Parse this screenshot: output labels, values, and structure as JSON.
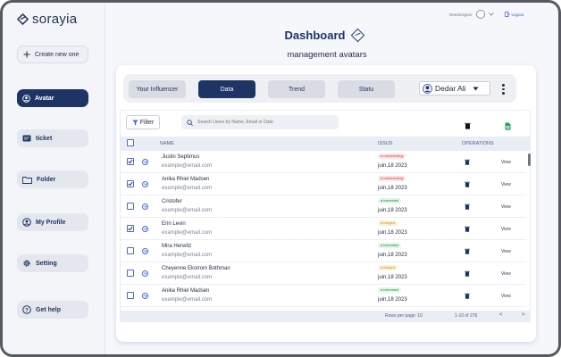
{
  "app": {
    "name": "sorayia"
  },
  "sidebar": {
    "create_label": "Create new one",
    "items": [
      {
        "label": "Avatar",
        "icon": "user-circle-icon",
        "active": true
      },
      {
        "label": "ticket",
        "icon": "ticket-icon",
        "active": false
      },
      {
        "label": "Folder",
        "icon": "folder-icon",
        "active": false
      },
      {
        "label": "My Profile",
        "icon": "profile-icon",
        "active": false
      },
      {
        "label": "Setting",
        "icon": "gear-icon",
        "active": false
      },
      {
        "label": "Get help",
        "icon": "help-icon",
        "active": false
      }
    ]
  },
  "topbar": {
    "username": "Deedesigner",
    "logout_label": "Logout"
  },
  "header": {
    "title": "Dashboard",
    "subtitle": "management avatars"
  },
  "tabs": [
    {
      "label": "Your Influencer",
      "active": false
    },
    {
      "label": "Data",
      "active": true
    },
    {
      "label": "Trend",
      "active": false
    },
    {
      "label": "Statu",
      "active": false
    }
  ],
  "user_select": {
    "value": "Dedar Ali"
  },
  "toolbar": {
    "filter_label": "Filter",
    "search_placeholder": "Search Users by Name, Email or Date"
  },
  "table": {
    "columns": {
      "name": "NAME",
      "issus": "ISSUS",
      "operations": "OPERATIONS"
    },
    "view_label": "View",
    "rows": [
      {
        "name": "Justin Septimus",
        "email": "example@email.com",
        "status": "uninteresting",
        "status_color": "red",
        "date": "juin,18 2023",
        "checked": true
      },
      {
        "name": "Anika Rhiel Madsen",
        "email": "example@email.com",
        "status": "uninteresting",
        "status_color": "red",
        "date": "juin,18 2023",
        "checked": true
      },
      {
        "name": "Cristofer",
        "email": "example@email.com",
        "status": "interested",
        "status_color": "green",
        "date": "juin,18 2023",
        "checked": false
      },
      {
        "name": "Erin Levin",
        "email": "example@email.com",
        "status": "intriged",
        "status_color": "orange",
        "date": "juin,18 2023",
        "checked": true
      },
      {
        "name": "Mira Herwitz",
        "email": "example@email.com",
        "status": "interested",
        "status_color": "green",
        "date": "juin,18 2023",
        "checked": false
      },
      {
        "name": "Cheyenne Ekstrom Bothman",
        "email": "example@email.com",
        "status": "intriged",
        "status_color": "orange",
        "date": "juin,18 2023",
        "checked": false
      },
      {
        "name": "Anika Rhiel Madsen",
        "email": "example@email.com",
        "status": "interested",
        "status_color": "green",
        "date": "juin,18 2023",
        "checked": false
      }
    ]
  },
  "pagination": {
    "rows_per_page_label": "Rows per page: 10",
    "range_label": "1-10 of 276",
    "prev": "<",
    "next": ">"
  },
  "colors": {
    "primary": "#1e3465",
    "accent_blue": "#4b6bd6",
    "status_red": "#d33838",
    "status_green": "#1b8a3a",
    "status_orange": "#d7871b"
  }
}
